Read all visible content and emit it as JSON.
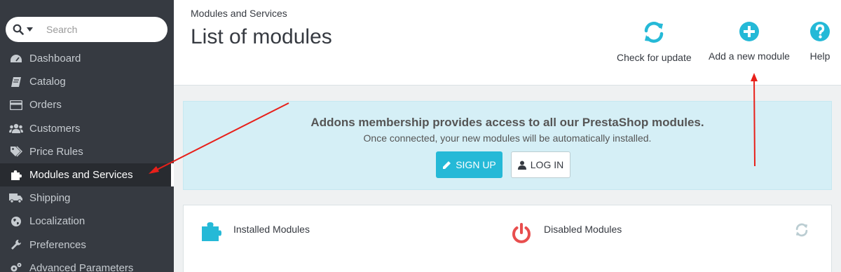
{
  "search": {
    "placeholder": "Search"
  },
  "sidebar": {
    "items": [
      {
        "label": "Dashboard",
        "icon": "dashboard-icon"
      },
      {
        "label": "Catalog",
        "icon": "book-icon"
      },
      {
        "label": "Orders",
        "icon": "credit-card-icon"
      },
      {
        "label": "Customers",
        "icon": "users-icon"
      },
      {
        "label": "Price Rules",
        "icon": "tags-icon"
      },
      {
        "label": "Modules and Services",
        "icon": "puzzle-icon",
        "active": true
      },
      {
        "label": "Shipping",
        "icon": "truck-icon"
      },
      {
        "label": "Localization",
        "icon": "globe-icon"
      },
      {
        "label": "Preferences",
        "icon": "wrench-icon"
      },
      {
        "label": "Advanced Parameters",
        "icon": "cogs-icon"
      }
    ]
  },
  "header": {
    "breadcrumb": "Modules and Services",
    "title": "List of modules",
    "toolbar": {
      "check_update": "Check for update",
      "add_module": "Add a new module",
      "help": "Help"
    }
  },
  "banner": {
    "title": "Addons membership provides access to all our PrestaShop modules.",
    "subtitle": "Once connected, your new modules will be automatically installed.",
    "signup": "SIGN UP",
    "login": "LOG IN"
  },
  "modules": {
    "installed": "Installed Modules",
    "disabled": "Disabled Modules"
  },
  "colors": {
    "accent": "#25b9d7",
    "sidebar": "#363a41",
    "banner": "#d5eff6",
    "danger": "#e84e4e",
    "arrow": "#e8201a"
  }
}
